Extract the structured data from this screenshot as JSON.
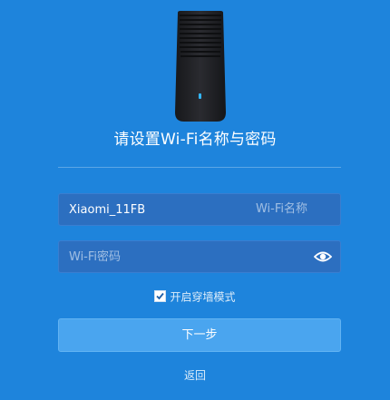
{
  "device": {
    "icon": "router-device-icon",
    "led_color": "#33b7ff",
    "body_color": "#1f2024"
  },
  "heading": "请设置Wi-Fi名称与密码",
  "ssid_field": {
    "value": "Xiaomi_11FB",
    "hint": "Wi-Fi名称"
  },
  "password_field": {
    "value": "",
    "placeholder": "Wi-Fi密码",
    "toggle_icon": "eye-icon"
  },
  "wall_mode": {
    "checked": true,
    "label": "开启穿墙模式"
  },
  "next_button": {
    "label": "下一步"
  },
  "back_link": {
    "label": "返回"
  },
  "colors": {
    "background": "#1e84dc",
    "input_background": "#2c6fc0",
    "button_background": "#4aa5ef"
  }
}
